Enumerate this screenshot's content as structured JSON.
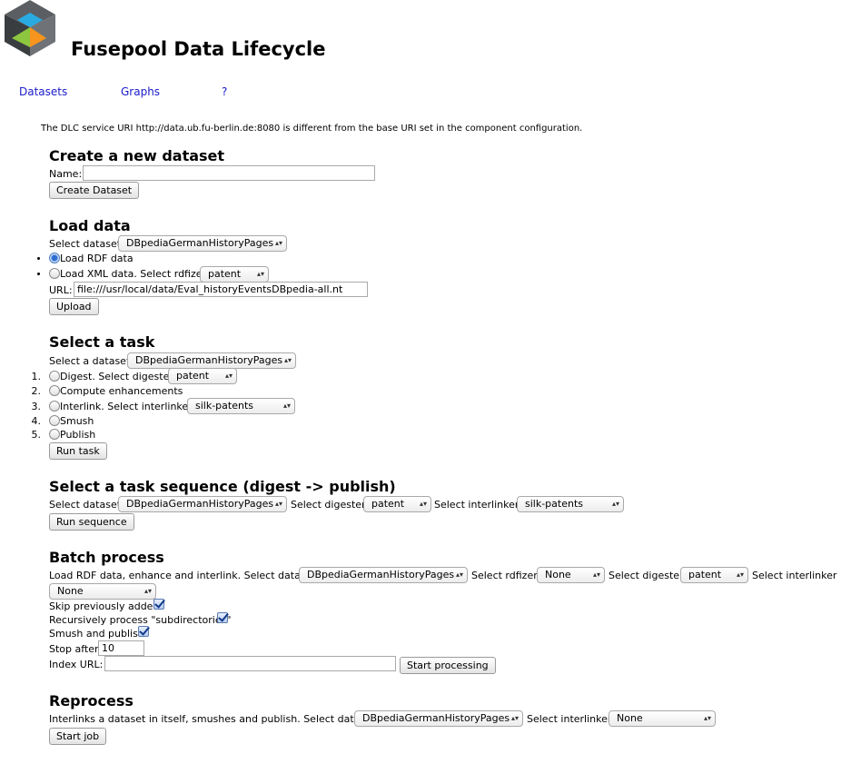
{
  "app": {
    "title": "Fusepool Data Lifecycle"
  },
  "nav": {
    "datasets": "Datasets",
    "graphs": "Graphs",
    "help": "?"
  },
  "notice": "The DLC service URI http://data.ub.fu-berlin.de:8080 is different from the base URI set in the component configuration.",
  "create": {
    "heading": "Create a new dataset",
    "name_label": "Name:",
    "name_value": "",
    "button": "Create Dataset"
  },
  "load": {
    "heading": "Load data",
    "dataset_label": "Select dataset",
    "dataset_value": "DBpediaGermanHistoryPages",
    "rdf_option": "Load RDF data",
    "xml_option": "Load XML data. Select rdfizer",
    "rdfizer_value": "patent",
    "url_label": "URL:",
    "url_value": "file:///usr/local/data/Eval_historyEventsDBpedia-all.nt",
    "button": "Upload"
  },
  "task": {
    "heading": "Select a task",
    "dataset_label": "Select a dataset",
    "dataset_value": "DBpediaGermanHistoryPages",
    "items": [
      {
        "num": "1.",
        "label": "Digest. Select digester",
        "select": "patent"
      },
      {
        "num": "2.",
        "label": "Compute enhancements"
      },
      {
        "num": "3.",
        "label": "Interlink. Select interlinker",
        "select": "silk-patents"
      },
      {
        "num": "4.",
        "label": "Smush"
      },
      {
        "num": "5.",
        "label": "Publish"
      }
    ],
    "button": "Run task"
  },
  "sequence": {
    "heading": "Select a task sequence (digest -> publish)",
    "dataset_label": "Select dataset",
    "dataset_value": "DBpediaGermanHistoryPages",
    "digester_label": "Select digester",
    "digester_value": "patent",
    "interlinker_label": "Select interlinker",
    "interlinker_value": "silk-patents",
    "button": "Run sequence"
  },
  "batch": {
    "heading": "Batch process",
    "intro": "Load RDF data, enhance and interlink. Select dataset",
    "dataset_value": "DBpediaGermanHistoryPages",
    "rdfizer_label": "Select rdfizer",
    "rdfizer_value": "None",
    "digester_label": "Select digester",
    "digester_value": "patent",
    "interlinker_label": "Select interlinker",
    "interlinker_value": "None",
    "skip_label": "Skip previously added",
    "recursive_label": "Recursively process \"subdirectories\"",
    "smush_label": "Smush and publish",
    "stop_label": "Stop after",
    "stop_value": "10",
    "index_label": "Index URL:",
    "index_value": "",
    "button": "Start processing"
  },
  "reprocess": {
    "heading": "Reprocess",
    "intro": "Interlinks a dataset in itself, smushes and publish. Select dataset",
    "dataset_value": "DBpediaGermanHistoryPages",
    "interlinker_label": "Select interlinker",
    "interlinker_value": "None",
    "button": "Start job"
  },
  "colors": {
    "link": "#1a1acc",
    "radio_selected": "#2f6fd3"
  },
  "icons": {
    "logo": "fusepool-cube-logo",
    "select": "chevron-updown-icon",
    "check": "checkmark-icon"
  }
}
